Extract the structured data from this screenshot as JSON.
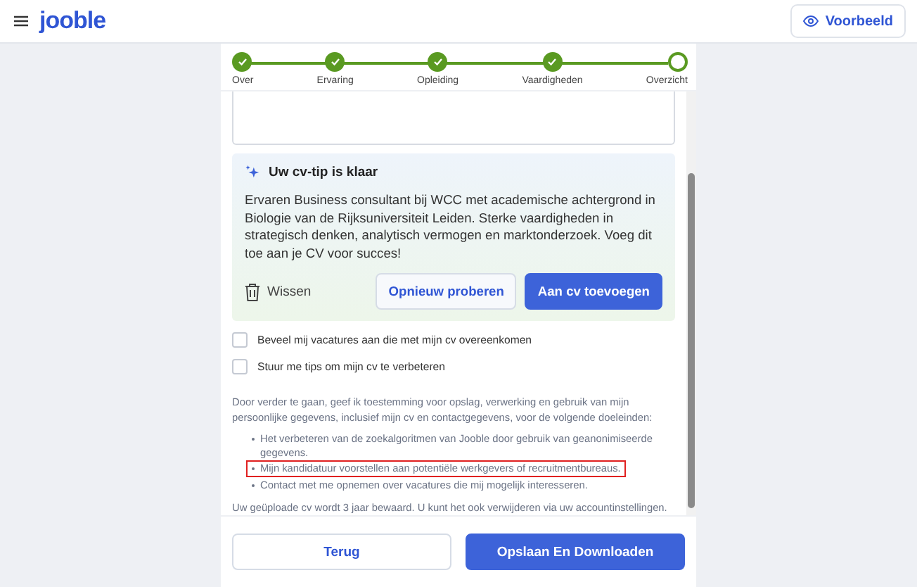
{
  "header": {
    "logo": "jooble",
    "preview_button": "Voorbeeld"
  },
  "stepper": [
    {
      "label": "Over",
      "completed": true
    },
    {
      "label": "Ervaring",
      "completed": true
    },
    {
      "label": "Opleiding",
      "completed": true
    },
    {
      "label": "Vaardigheden",
      "completed": true
    },
    {
      "label": "Overzicht",
      "completed": false
    }
  ],
  "tip": {
    "title": "Uw cv-tip is klaar",
    "text": "Ervaren Business consultant bij WCC met academische achtergrond in Biologie van de Rijksuniversiteit Leiden. Sterke vaardigheden in strategisch denken, analytisch vermogen en marktonderzoek. Voeg dit toe aan je CV voor succes!",
    "clear_button": "Wissen",
    "retry_button": "Opnieuw proberen",
    "add_button": "Aan cv toevoegen"
  },
  "checkboxes": [
    {
      "label": "Beveel mij vacatures aan die met mijn cv overeenkomen",
      "checked": false
    },
    {
      "label": "Stuur me tips om mijn cv te verbeteren",
      "checked": false
    }
  ],
  "consent": {
    "intro": "Door verder te gaan, geef ik toestemming voor opslag, verwerking en gebruik van mijn persoonlijke gegevens, inclusief mijn cv en contactgegevens, voor de volgende doeleinden:",
    "items": [
      {
        "text": "Het verbeteren van de zoekalgoritmen van Jooble door gebruik van geanonimiseerde gegevens.",
        "highlighted": false
      },
      {
        "text": "Mijn kandidatuur voorstellen aan potentiële werkgevers of recruitmentbureaus.",
        "highlighted": true
      },
      {
        "text": "Contact met me opnemen over vacatures die mij mogelijk interesseren.",
        "highlighted": false
      }
    ],
    "retention": "Uw geüploade cv wordt 3 jaar bewaard. U kunt het ook verwijderen via uw accountinstellingen."
  },
  "footer": {
    "back_button": "Terug",
    "save_button": "Opslaan En Downloaden"
  }
}
